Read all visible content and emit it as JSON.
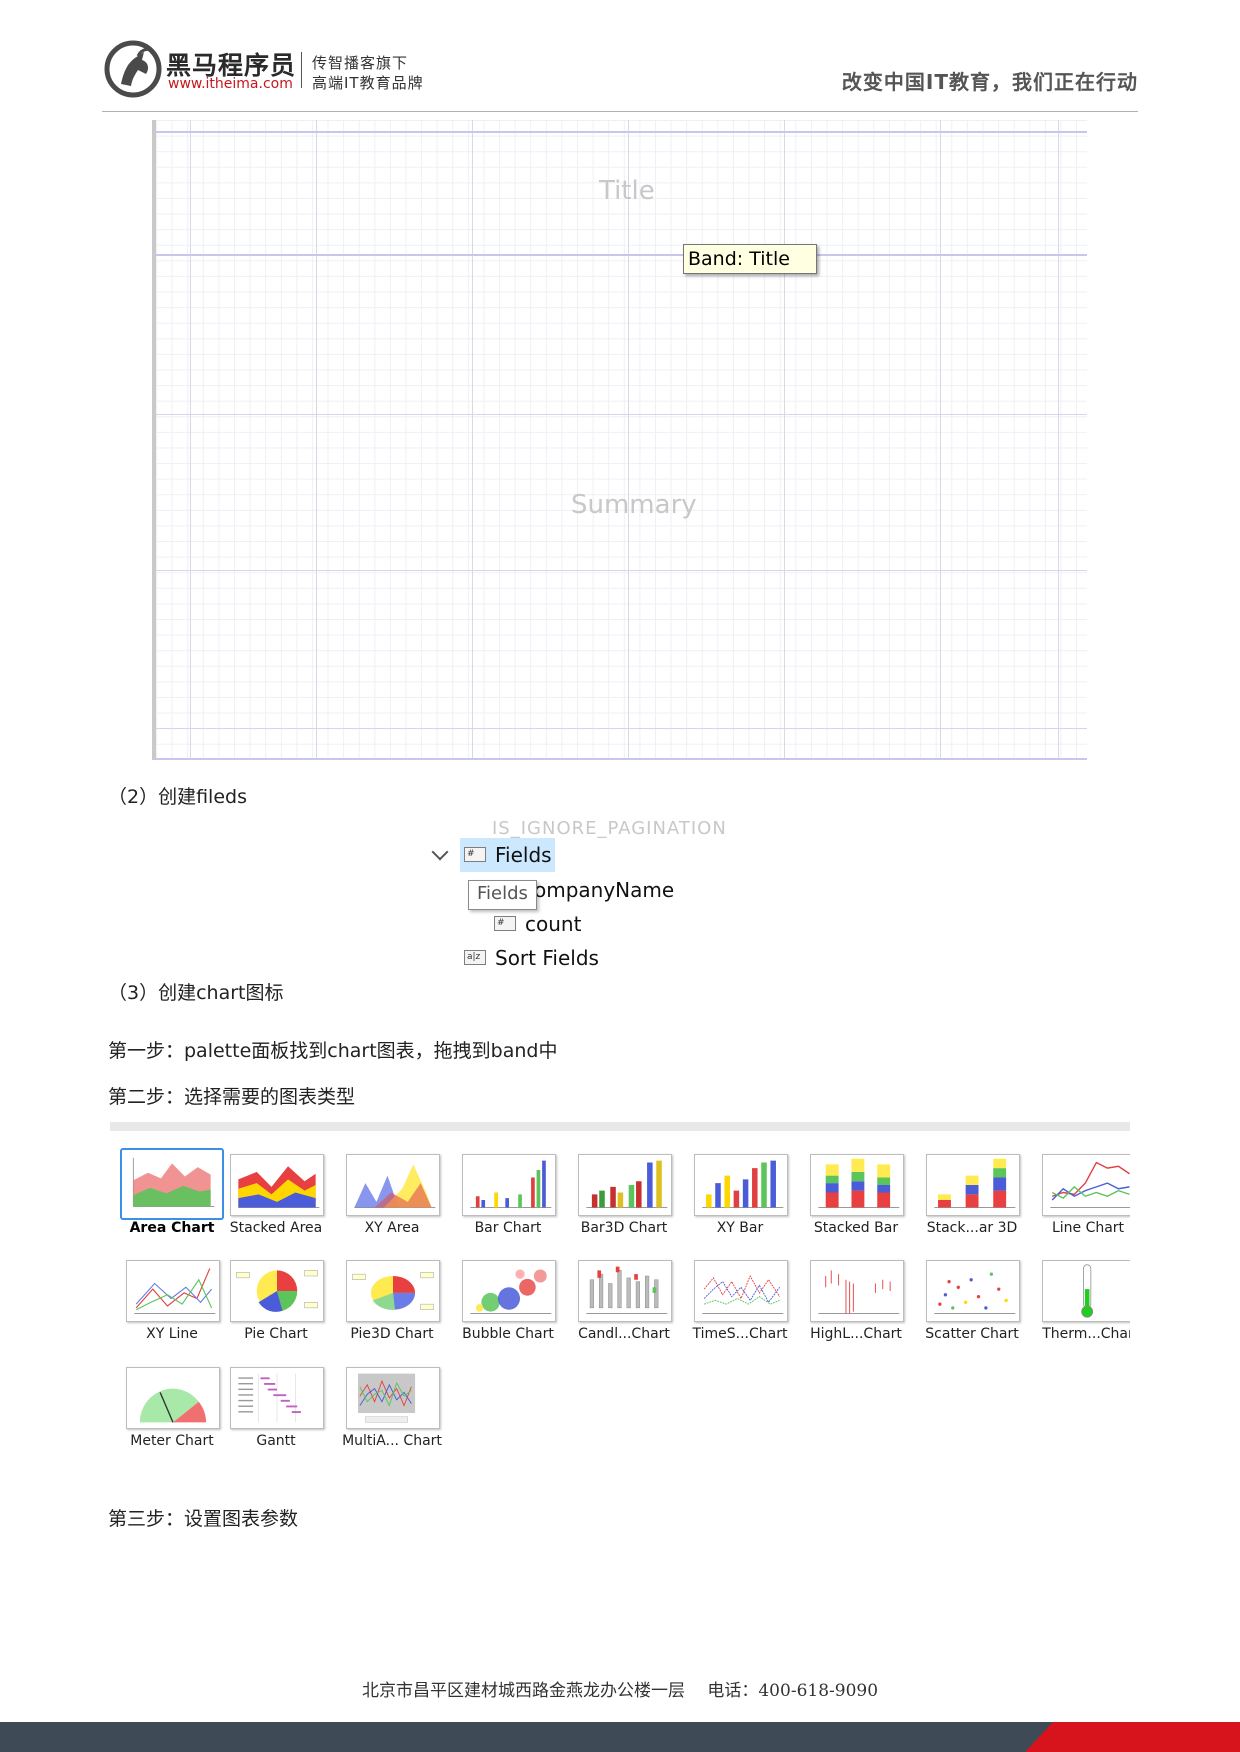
{
  "header": {
    "brand_name": "黑马程序员",
    "brand_url": "www.itheima.com",
    "slogan_line1": "传智播客旗下",
    "slogan_line2": "高端IT教育品牌",
    "motto": "改变中国IT教育，我们正在行动",
    "brand_color": "#c8161d"
  },
  "designer": {
    "band_title": "Title",
    "band_summary": "Summary",
    "tooltip": "Band: Title"
  },
  "steps": {
    "s2": "（2）创建fileds",
    "s3": "（3）创建chart图标",
    "step1": "第一步：palette面板找到chart图表，拖拽到band中",
    "step2": "第二步：选择需要的图表类型",
    "step3": "第三步：设置图表参数"
  },
  "tree": {
    "ghost_label": "IS_IGNORE_PAGINATION",
    "fields_label": "Fields",
    "field1": "ompanyName",
    "field2": "count",
    "sort_fields": "Sort Fields",
    "tooltip": "Fields",
    "icon_hash": "#",
    "icon_az": "a|z"
  },
  "gallery": {
    "selected": "Area Chart",
    "items": [
      {
        "label": "Area Chart",
        "icon": "area-chart-icon"
      },
      {
        "label": "Stacked Area",
        "icon": "stacked-area-icon"
      },
      {
        "label": "XY Area",
        "icon": "xy-area-icon"
      },
      {
        "label": "Bar Chart",
        "icon": "bar-chart-icon"
      },
      {
        "label": "Bar3D Chart",
        "icon": "bar3d-chart-icon"
      },
      {
        "label": "XY Bar",
        "icon": "xy-bar-icon"
      },
      {
        "label": "Stacked Bar",
        "icon": "stacked-bar-icon"
      },
      {
        "label": "Stack...ar 3D",
        "icon": "stacked-bar3d-icon"
      },
      {
        "label": "Line Chart",
        "icon": "line-chart-icon"
      },
      {
        "label": "XY Line",
        "icon": "xy-line-icon"
      },
      {
        "label": "Pie Chart",
        "icon": "pie-chart-icon"
      },
      {
        "label": "Pie3D Chart",
        "icon": "pie3d-chart-icon"
      },
      {
        "label": "Bubble Chart",
        "icon": "bubble-chart-icon"
      },
      {
        "label": "Candl...Chart",
        "icon": "candlestick-chart-icon"
      },
      {
        "label": "TimeS...Chart",
        "icon": "timeseries-chart-icon"
      },
      {
        "label": "HighL...Chart",
        "icon": "highlow-chart-icon"
      },
      {
        "label": "Scatter Chart",
        "icon": "scatter-chart-icon"
      },
      {
        "label": "Therm...Char",
        "icon": "thermometer-chart-icon"
      },
      {
        "label": "Meter Chart",
        "icon": "meter-chart-icon"
      },
      {
        "label": "Gantt",
        "icon": "gantt-chart-icon"
      },
      {
        "label": "MultiA... Chart",
        "icon": "multiaxis-chart-icon"
      }
    ]
  },
  "footer": {
    "address": "北京市昌平区建材城西路金燕龙办公楼一层　 电话：400-618-9090",
    "bar_color": "#3e4a55",
    "accent_color": "#d7141b"
  }
}
